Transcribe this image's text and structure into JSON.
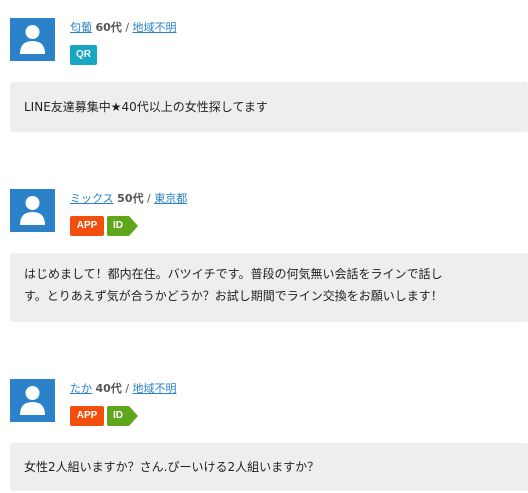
{
  "posts": [
    {
      "username": "匂葡",
      "age": "60代",
      "separator": "/",
      "region": "地域不明",
      "badges": [
        "QR"
      ],
      "message_lines": [
        "LINE友達募集中★40代以上の女性探してます"
      ]
    },
    {
      "username": "ミックス",
      "age": "50代",
      "separator": "/",
      "region": "東京都",
      "badges": [
        "APP",
        "ID"
      ],
      "message_lines": [
        "はじめまして！都内在住。バツイチです。普段の何気無い会話をラインで話し",
        "す。とりあえず気が合うかどうか？お試し期間でライン交換をお願いします！"
      ]
    },
    {
      "username": "たか",
      "age": "40代",
      "separator": "/",
      "region": "地域不明",
      "badges": [
        "APP",
        "ID"
      ],
      "message_lines": [
        "女性2人組いますか？さん.ぴーいける2人組いますか？"
      ]
    }
  ],
  "colors": {
    "avatar": "#2b82c9",
    "link": "#2b82c9",
    "qr_badge": "#17a6c3",
    "app_badge": "#f24f0e",
    "id_badge": "#5fa61b",
    "bubble": "#eeeeee"
  },
  "icons": {
    "avatar": "person-silhouette-icon"
  }
}
